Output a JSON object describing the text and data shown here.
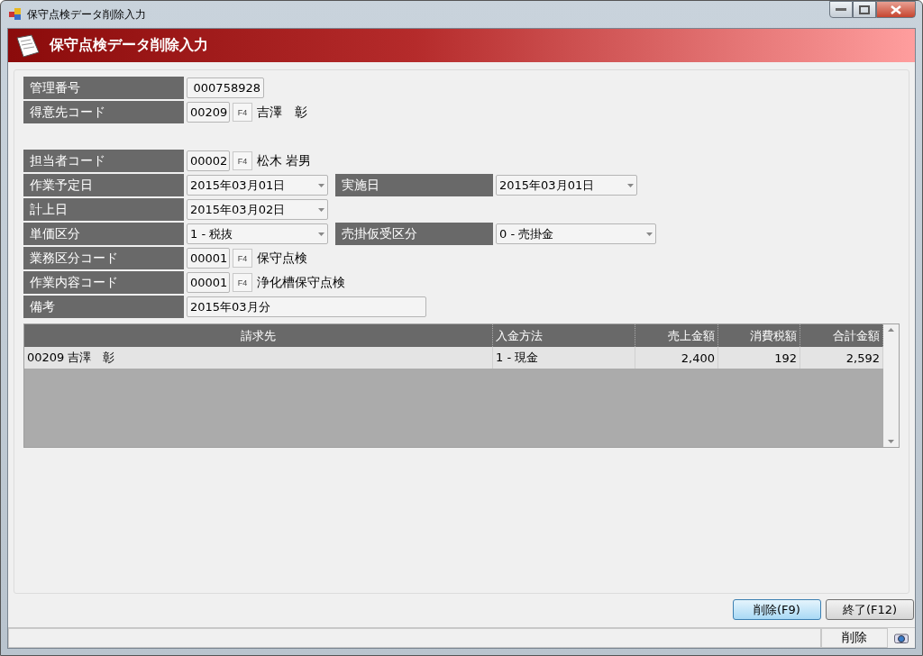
{
  "window": {
    "title": "保守点検データ削除入力"
  },
  "header": {
    "title": "保守点検データ削除入力"
  },
  "form_sections": [
    [
      {
        "items": [
          {
            "kind": "text",
            "label": "管理番号",
            "value": "000758928"
          }
        ]
      },
      {
        "items": [
          {
            "kind": "code",
            "label": "得意先コード",
            "value": "00209",
            "key": "F4",
            "name": "吉澤　彰"
          }
        ]
      }
    ],
    [
      {
        "items": [
          {
            "kind": "code",
            "label": "担当者コード",
            "value": "00002",
            "key": "F4",
            "name": "松木 岩男"
          }
        ]
      },
      {
        "items": [
          {
            "kind": "date",
            "label": "作業予定日",
            "value": "2015年03月01日"
          },
          {
            "kind": "date",
            "label": "実施日",
            "value": "2015年03月01日"
          }
        ]
      },
      {
        "items": [
          {
            "kind": "date",
            "label": "計上日",
            "value": "2015年03月02日"
          }
        ]
      },
      {
        "items": [
          {
            "kind": "select",
            "label": "単価区分",
            "value": "1 - 税抜"
          },
          {
            "kind": "select",
            "label": "売掛仮受区分",
            "value": "0 - 売掛金"
          }
        ]
      },
      {
        "items": [
          {
            "kind": "code",
            "label": "業務区分コード",
            "value": "00001",
            "key": "F4",
            "name": "保守点検"
          }
        ]
      },
      {
        "items": [
          {
            "kind": "code",
            "label": "作業内容コード",
            "value": "00001",
            "key": "F4",
            "name": "浄化槽保守点検"
          }
        ]
      },
      {
        "items": [
          {
            "kind": "memo",
            "label": "備考",
            "value": "2015年03月分"
          }
        ]
      }
    ]
  ],
  "table": {
    "columns": [
      "請求先",
      "入金方法",
      "売上金額",
      "消費税額",
      "合計金額"
    ],
    "rows": [
      {
        "selected": false,
        "cells": [
          "00209 吉澤　彰",
          "1 - 現金",
          "2,400",
          "192",
          "2,592"
        ]
      }
    ]
  },
  "buttons": [
    {
      "label": "削除(F9)",
      "default": true
    },
    {
      "label": "終了(F12)",
      "default": false
    }
  ],
  "status_bar": {
    "mode": "削除"
  }
}
